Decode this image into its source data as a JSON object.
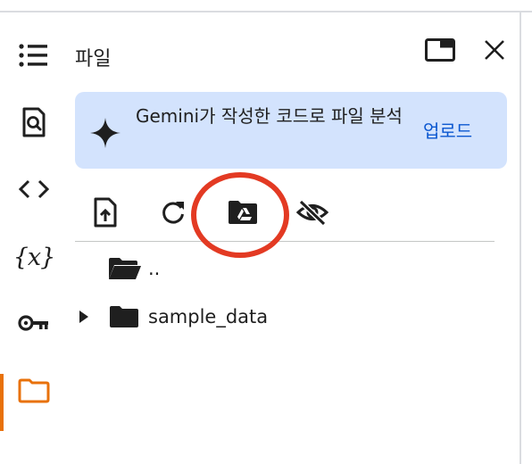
{
  "panel": {
    "title": "파일"
  },
  "rail": {
    "items": [
      {
        "icon": "table-of-contents-icon"
      },
      {
        "icon": "find-replace-icon"
      },
      {
        "icon": "code-snippets-icon"
      },
      {
        "icon": "variables-icon",
        "label": "{x}"
      },
      {
        "icon": "secrets-key-icon"
      },
      {
        "icon": "files-folder-icon",
        "active": true
      }
    ]
  },
  "gemini": {
    "text": "Gemini가 작성한 코드로 파일 분석",
    "action_label": "업로드"
  },
  "toolbar": {
    "buttons": [
      "upload-file-icon",
      "refresh-icon",
      "mount-drive-icon",
      "hidden-files-icon"
    ]
  },
  "files": [
    {
      "name": "..",
      "type": "parent-folder"
    },
    {
      "name": "sample_data",
      "type": "folder",
      "expandable": true
    }
  ],
  "colors": {
    "accent_orange": "#e8710a",
    "banner_bg": "#d3e3fd",
    "link_blue": "#0b57d0",
    "annotation_red": "#e33a23"
  }
}
